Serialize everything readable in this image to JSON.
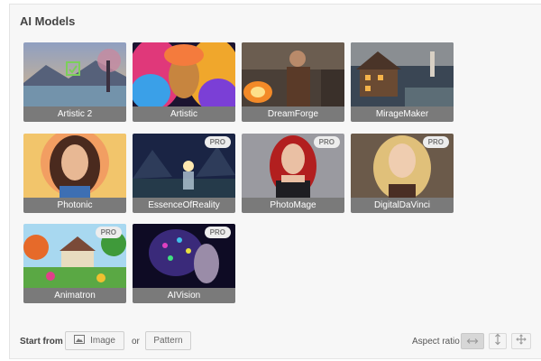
{
  "section": {
    "title": "AI Models"
  },
  "models": [
    {
      "name": "Artistic 2",
      "pro": false,
      "selected": true
    },
    {
      "name": "Artistic",
      "pro": false,
      "selected": false
    },
    {
      "name": "DreamForge",
      "pro": false,
      "selected": false
    },
    {
      "name": "MirageMaker",
      "pro": false,
      "selected": false
    },
    {
      "name": "Photonic",
      "pro": false,
      "selected": false
    },
    {
      "name": "EssenceOfReality",
      "pro": true,
      "selected": false
    },
    {
      "name": "PhotoMage",
      "pro": true,
      "selected": false
    },
    {
      "name": "DigitalDaVinci",
      "pro": true,
      "selected": false
    },
    {
      "name": "Animatron",
      "pro": true,
      "selected": false
    },
    {
      "name": "AIVision",
      "pro": true,
      "selected": false
    }
  ],
  "badge": {
    "pro_label": "PRO"
  },
  "footer": {
    "start_from_label": "Start from",
    "image_button": "Image",
    "or_label": "or",
    "pattern_button": "Pattern",
    "aspect_label": "Aspect ratio"
  },
  "icons": {
    "image_button_icon": "image-icon",
    "aspect_buttons": [
      "horizontal-arrows-icon",
      "vertical-arrows-icon",
      "move-arrows-icon"
    ]
  }
}
